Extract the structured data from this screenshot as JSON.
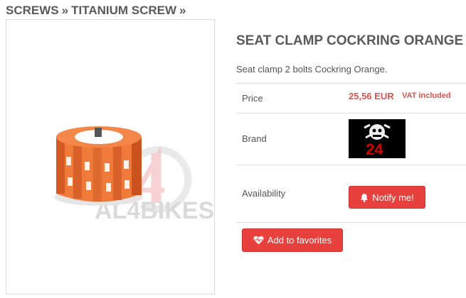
{
  "breadcrumb": {
    "items": [
      "SCREWS",
      "TITANIUM SCREW"
    ],
    "separator": "»"
  },
  "product": {
    "title": "SEAT CLAMP COCKRING ORANGE",
    "description": "Seat clamp 2 bolts Cockring Orange.",
    "image_watermark": "AL4BIKES",
    "price_label": "Price",
    "price": "25,56 EUR",
    "vat": "VAT included",
    "brand_label": "Brand",
    "brand_logo_text": "24",
    "availability_label": "Availability"
  },
  "buttons": {
    "notify": "Notify me!",
    "favorites": "Add to favorites"
  },
  "colors": {
    "accent": "#e8403c",
    "price": "#d9534f",
    "product_orange": "#f26b2a"
  },
  "icons": {
    "notify": "bell-icon",
    "favorites": "heart-pulse-icon"
  }
}
